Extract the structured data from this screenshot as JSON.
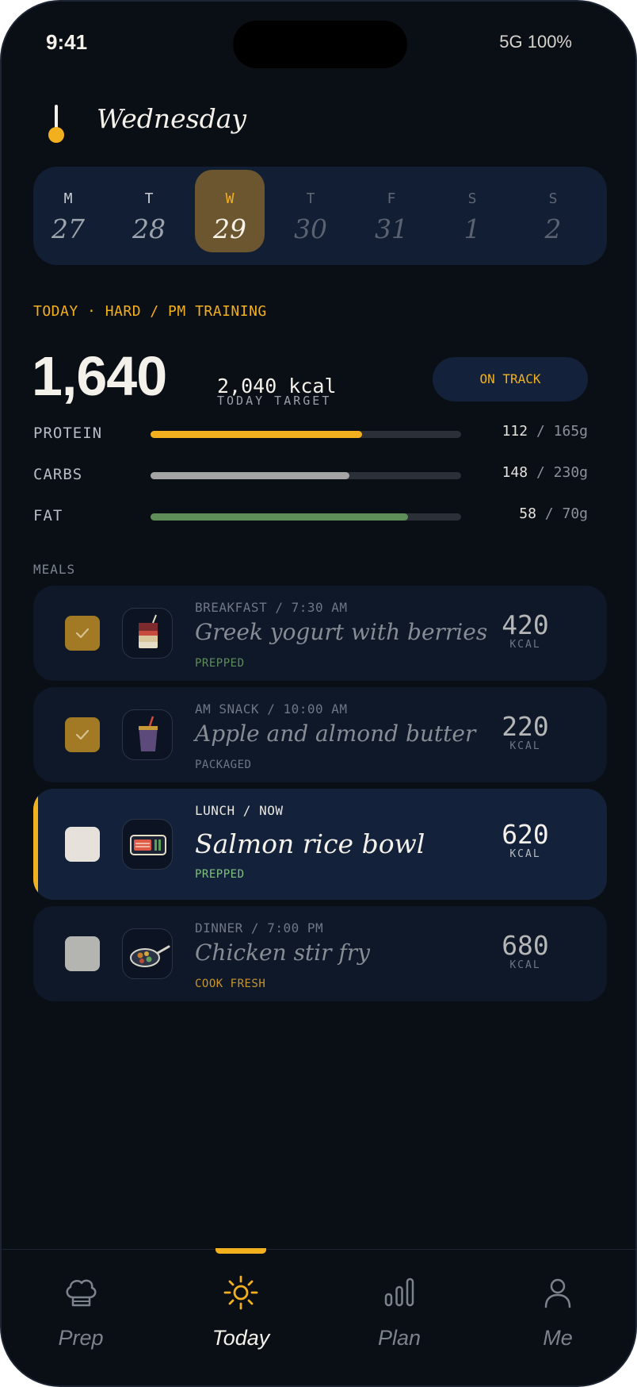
{
  "status": {
    "time": "9:41",
    "network": "5G 100%"
  },
  "header": {
    "day": "Wednesday"
  },
  "week": [
    {
      "letter": "M",
      "date": "27"
    },
    {
      "letter": "T",
      "date": "28"
    },
    {
      "letter": "W",
      "date": "29"
    },
    {
      "letter": "T",
      "date": "30"
    },
    {
      "letter": "F",
      "date": "31"
    },
    {
      "letter": "S",
      "date": "1"
    },
    {
      "letter": "S",
      "date": "2"
    }
  ],
  "summary": {
    "label": "TODAY · HARD / PM TRAINING",
    "consumed": "1,640",
    "target_value": "2,040 kcal",
    "target_label": "TODAY TARGET",
    "status": "ON TRACK"
  },
  "macros": [
    {
      "name": "PROTEIN",
      "current": "112",
      "goal": "165g",
      "progress": 0.68,
      "color": "#f2b01e"
    },
    {
      "name": "CARBS",
      "current": "148",
      "goal": "230g",
      "progress": 0.64,
      "color": "#a4a4a4"
    },
    {
      "name": "FAT",
      "current": "58",
      "goal": "70g",
      "progress": 0.83,
      "color": "#5f8f59"
    }
  ],
  "meals_label": "MEALS",
  "meals": [
    {
      "meta": "BREAKFAST / 7:30 AM",
      "title": "Greek yogurt with berries",
      "tag": "PREPPED",
      "tag_color": "#5d8c5a",
      "kcal": "420",
      "unit": "KCAL",
      "checked": true,
      "icon": "parfait-icon"
    },
    {
      "meta": "AM SNACK / 10:00 AM",
      "title": "Apple and almond butter",
      "tag": "PACKAGED",
      "tag_color": "#6f7684",
      "kcal": "220",
      "unit": "KCAL",
      "checked": true,
      "icon": "drink-cup-icon"
    },
    {
      "meta": "LUNCH / NOW",
      "title": "Salmon rice bowl",
      "tag": "PREPPED",
      "tag_color": "#7fc27f",
      "kcal": "620",
      "unit": "KCAL",
      "checked": false,
      "icon": "bento-box-icon"
    },
    {
      "meta": "DINNER / 7:00 PM",
      "title": "Chicken stir fry",
      "tag": "COOK FRESH",
      "tag_color": "#c8962b",
      "kcal": "680",
      "unit": "KCAL",
      "checked": false,
      "icon": "wok-pan-icon"
    }
  ],
  "tabs": [
    {
      "label": "Prep",
      "icon": "chef-hat-icon"
    },
    {
      "label": "Today",
      "icon": "sun-icon"
    },
    {
      "label": "Plan",
      "icon": "bar-chart-icon"
    },
    {
      "label": "Me",
      "icon": "person-icon"
    }
  ],
  "colors": {
    "accent": "#f2b01e",
    "background": "#0a0e15",
    "card": "#111e34"
  }
}
